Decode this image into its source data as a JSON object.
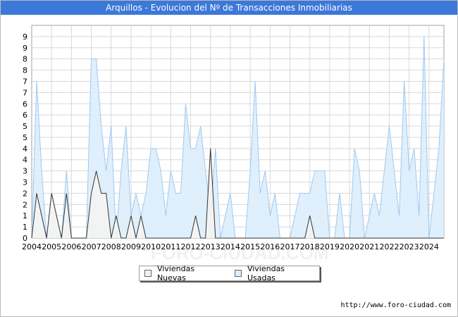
{
  "title": "Arquillos - Evolucion del Nº de Transacciones Inmobiliarias",
  "source": "http://www.foro-ciudad.com",
  "watermark": "FORO-CIUDAD.COM",
  "colors": {
    "title_bg": "#3c78d8",
    "nuevas_fill": "#f2f2f2",
    "nuevas_line": "#333333",
    "usadas_fill": "#ddeefc",
    "usadas_line": "#9ec9f2",
    "grid": "#d8d8d8"
  },
  "chart_data": {
    "type": "area",
    "title": "Arquillos - Evolucion del Nº de Transacciones Inmobiliarias",
    "x_start": 2004.0,
    "x_step": 0.25,
    "xlim": [
      2004.0,
      2024.75
    ],
    "x_tick_labels": [
      "2004",
      "2005",
      "2006",
      "2007",
      "2008",
      "2009",
      "2010",
      "2011",
      "2012",
      "2013",
      "2014",
      "2015",
      "2016",
      "2017",
      "2018",
      "2019",
      "2020",
      "2021",
      "2022",
      "2023",
      "2024"
    ],
    "ylim": [
      0,
      9.5
    ],
    "y_tick_labels": [
      "0",
      "1",
      "1",
      "2",
      "2",
      "3",
      "3",
      "4",
      "4",
      "5",
      "5",
      "6",
      "6",
      "7",
      "7",
      "8",
      "8",
      "9",
      "9"
    ],
    "grid": true,
    "legend_position": "bottom",
    "series": [
      {
        "name": "Viviendas Nuevas",
        "values": [
          0,
          2,
          1,
          0,
          2,
          1,
          0,
          2,
          0,
          0,
          0,
          0,
          2,
          3,
          2,
          2,
          0,
          1,
          0,
          0,
          1,
          0,
          1,
          0,
          0,
          0,
          0,
          0,
          0,
          0,
          0,
          0,
          0,
          1,
          0,
          0,
          4,
          0,
          0,
          0,
          0,
          0,
          0,
          0,
          0,
          0,
          0,
          0,
          0,
          0,
          0,
          0,
          0,
          0,
          0,
          0,
          1,
          0,
          0,
          0,
          0,
          0,
          0,
          0,
          0,
          0,
          0,
          0,
          0,
          0,
          0,
          0,
          0,
          0,
          0,
          0,
          0,
          0,
          0,
          0,
          0,
          0,
          0,
          0
        ]
      },
      {
        "name": "Viviendas Usadas",
        "values": [
          0,
          7,
          3,
          0,
          2,
          1,
          0,
          3,
          0,
          0,
          0,
          0,
          8,
          8,
          5,
          3,
          5,
          0,
          3,
          5,
          1,
          2,
          1,
          2,
          4,
          4,
          3,
          1,
          3,
          2,
          2,
          6,
          4,
          4,
          5,
          3,
          1,
          4,
          0,
          1,
          2,
          0,
          0,
          0,
          3,
          7,
          2,
          3,
          1,
          2,
          0,
          0,
          0,
          1,
          2,
          2,
          2,
          3,
          3,
          3,
          0,
          0,
          2,
          0,
          0,
          4,
          3,
          0,
          1,
          2,
          1,
          3,
          5,
          3,
          1,
          7,
          3,
          4,
          1,
          9,
          0,
          2,
          4,
          8
        ]
      }
    ]
  }
}
